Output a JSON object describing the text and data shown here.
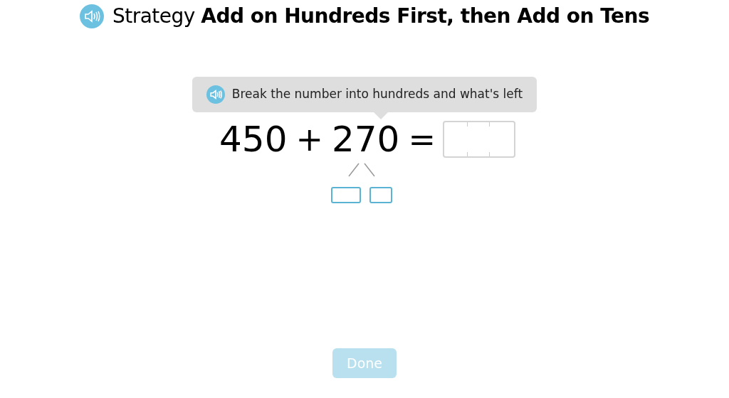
{
  "title": "Strategy **Add on Hundreds First, then Add on Tens**",
  "prompt": "Break the number into hundreds and what's left",
  "equation": [
    {
      "kind": "number",
      "text": "450"
    },
    {
      "kind": "operator",
      "text": "+"
    },
    {
      "kind": "split",
      "text": "270"
    },
    {
      "kind": "operator",
      "text": "="
    }
  ],
  "done_button": {
    "label": "Done",
    "disabled": true
  }
}
